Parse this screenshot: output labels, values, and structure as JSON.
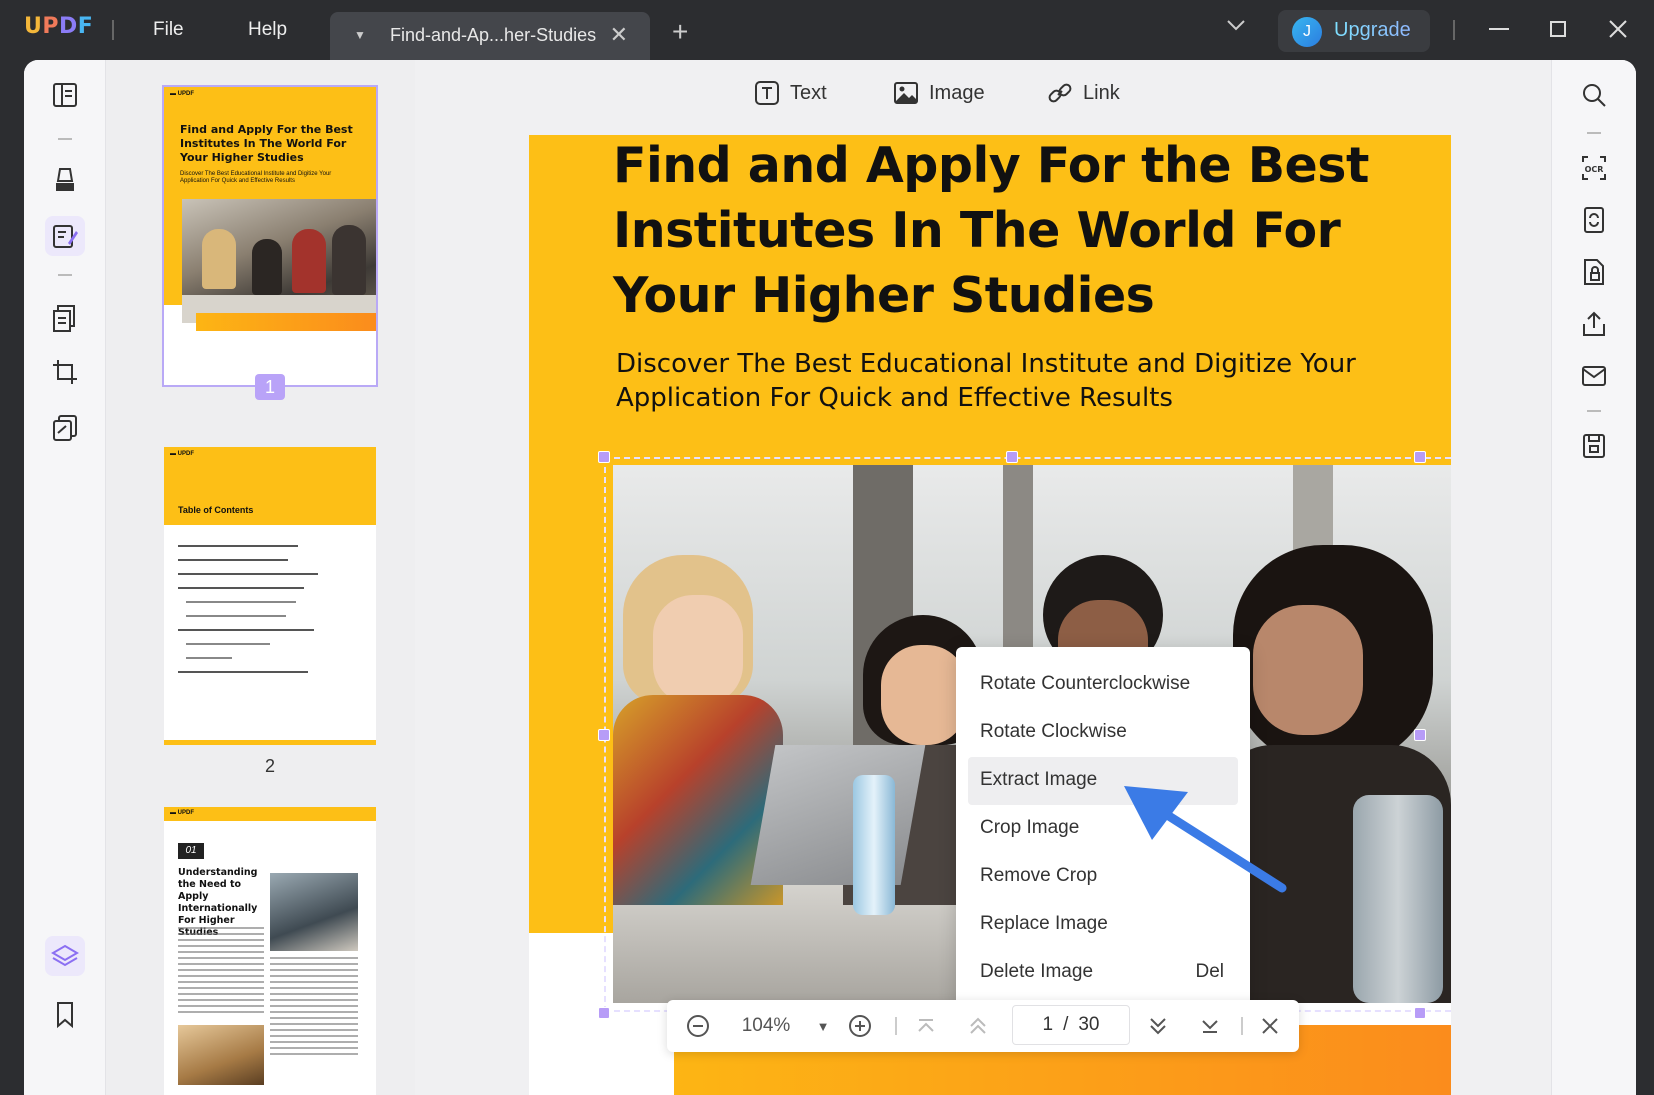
{
  "app": {
    "logo": "UPDF",
    "menu": [
      "File",
      "Help"
    ],
    "tab_title": "Find-and-Ap...her-Studies",
    "upgrade_avatar": "J",
    "upgrade_label": "Upgrade",
    "accent": "#8b6ff2"
  },
  "edit_toolbar": {
    "text_label": "Text",
    "image_label": "Image",
    "link_label": "Link"
  },
  "thumbnails": [
    {
      "number": "1",
      "title": "Find and Apply For the Best Institutes In The World For Your Higher Studies",
      "subtitle": "Discover The Best Educational Institute and Digitize Your Application For Quick and Effective Results"
    },
    {
      "number": "2",
      "heading": "Table of Contents"
    },
    {
      "number": "",
      "chapter_num": "01",
      "heading": "Understanding the Need to Apply Internationally For Higher Studies"
    }
  ],
  "page": {
    "title": "Find and Apply For the Best Institutes In The World For Your Higher Studies",
    "subtitle": "Discover The Best Educational Institute and Digitize Your Application For Quick and Effective Results"
  },
  "context_menu": {
    "items": [
      {
        "label": "Rotate Counterclockwise",
        "shortcut": ""
      },
      {
        "label": "Rotate Clockwise",
        "shortcut": ""
      },
      {
        "label": "Extract Image",
        "shortcut": ""
      },
      {
        "label": "Crop Image",
        "shortcut": ""
      },
      {
        "label": "Remove Crop",
        "shortcut": ""
      },
      {
        "label": "Replace Image",
        "shortcut": ""
      },
      {
        "label": "Delete Image",
        "shortcut": "Del"
      }
    ],
    "hovered": "Extract Image"
  },
  "navbar": {
    "zoom": "104%",
    "current_page": "1",
    "separator": "/",
    "total_pages": "30"
  },
  "colors": {
    "page_yellow": "#fdbf16",
    "page_orange": "#fb8c1c",
    "selection_handle": "#b79cf7",
    "arrow_blue": "#3b7be6"
  }
}
